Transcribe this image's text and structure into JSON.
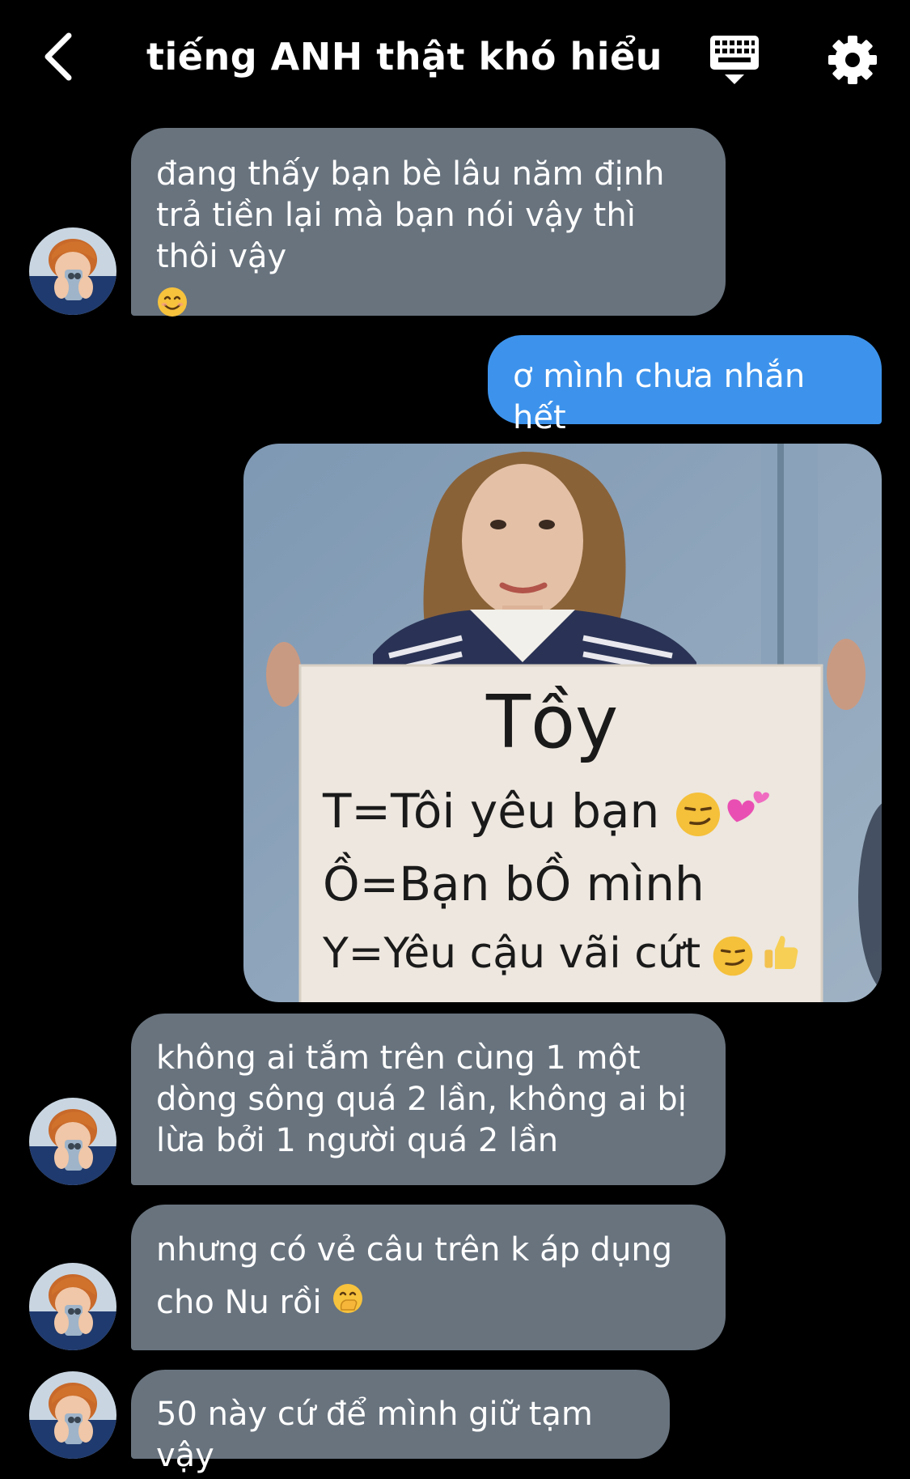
{
  "header": {
    "title": "tiếng ANH thật khó hiểu",
    "back_icon": "chevron-left-icon",
    "keyboard_icon": "keyboard-icon",
    "settings_icon": "gear-icon"
  },
  "colors": {
    "background": "#000000",
    "incoming_bubble": "#68737e",
    "outgoing_bubble": "#3d93ec",
    "text": "#ffffff"
  },
  "messages": [
    {
      "direction": "incoming",
      "text": "đang thấy bạn bè lâu năm định trả tiền lại mà bạn nói vậy thì thôi vậy",
      "emoji": "smiling-face-emoji"
    },
    {
      "direction": "outgoing",
      "text": "ơ mình chưa nhắn hết"
    },
    {
      "direction": "outgoing",
      "type": "image",
      "image": {
        "sign_title": "Tồy",
        "sign_line_1": "T=Tôi yêu bạn",
        "sign_line_2": "Ồ=Bạn bỒ mình",
        "sign_line_3": "Y=Yêu cậu vãi cứt"
      }
    },
    {
      "direction": "incoming",
      "text": "không ai tắm trên cùng 1 một dòng sông quá 2 lần, không ai bị lừa bởi 1 người quá 2 lần"
    },
    {
      "direction": "incoming",
      "text": "nhưng có vẻ câu trên k áp dụng cho Nu rồi",
      "emoji": "face-with-hand-over-mouth-emoji"
    },
    {
      "direction": "incoming",
      "text": "50 này cứ để mình giữ tạm vậy"
    }
  ]
}
